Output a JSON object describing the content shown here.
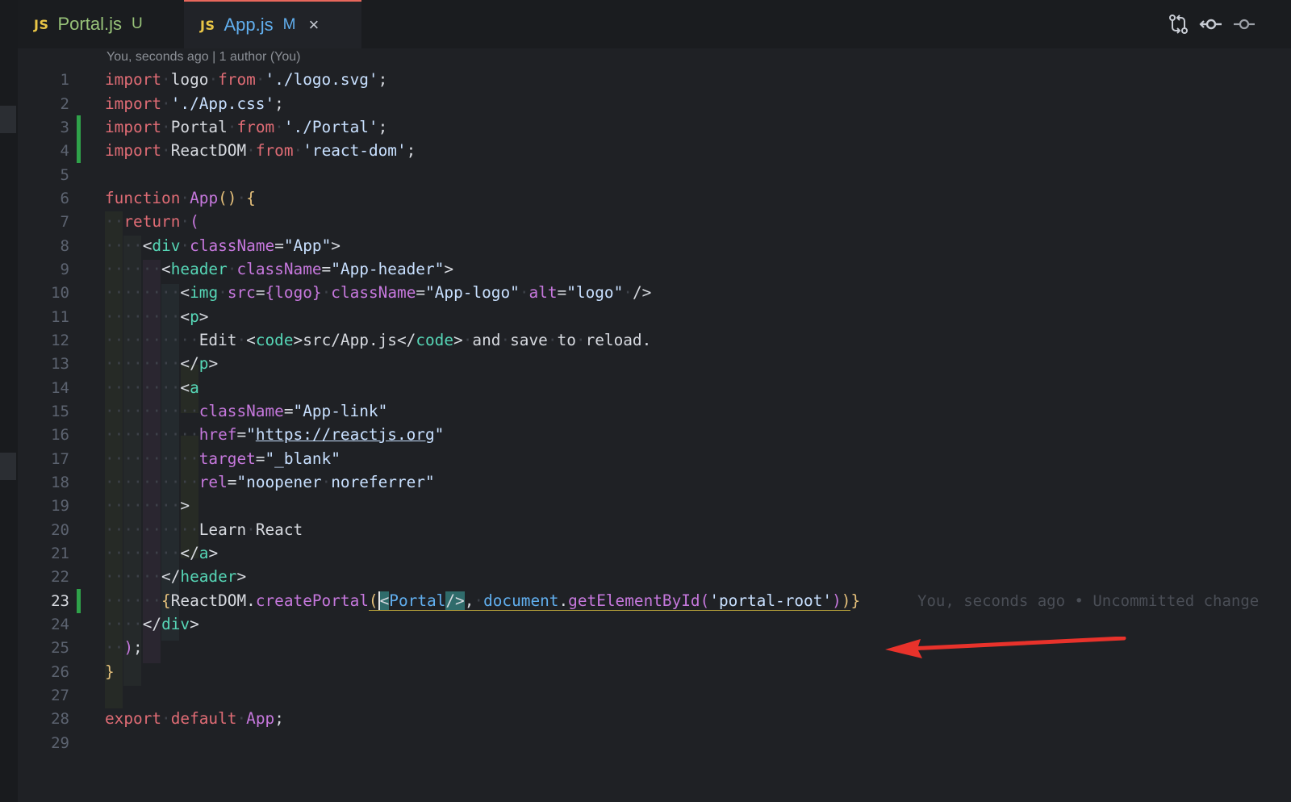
{
  "tabs": [
    {
      "badge": "JS",
      "name": "Portal.js",
      "status": "U"
    },
    {
      "badge": "JS",
      "name": "App.js",
      "status": "M",
      "close": "×"
    }
  ],
  "toolbar": {
    "icons": [
      "compare-changes-icon",
      "git-commit-prev-icon",
      "git-commit-next-icon"
    ]
  },
  "blame_header": "You, seconds ago | 1 author (You)",
  "ghost_blame": "You, seconds ago • Uncommitted change",
  "code_lines": [
    {
      "n": "1",
      "text": "import logo from './logo.svg';"
    },
    {
      "n": "2",
      "text": "import './App.css';"
    },
    {
      "n": "3",
      "text": "import Portal from './Portal';"
    },
    {
      "n": "4",
      "text": "import ReactDOM from 'react-dom';"
    },
    {
      "n": "5",
      "text": ""
    },
    {
      "n": "6",
      "text": "function App() {"
    },
    {
      "n": "7",
      "text": "  return ("
    },
    {
      "n": "8",
      "text": "    <div className=\"App\">"
    },
    {
      "n": "9",
      "text": "      <header className=\"App-header\">"
    },
    {
      "n": "10",
      "text": "        <img src={logo} className=\"App-logo\" alt=\"logo\" />"
    },
    {
      "n": "11",
      "text": "        <p>"
    },
    {
      "n": "12",
      "text": "          Edit <code>src/App.js</code> and save to reload."
    },
    {
      "n": "13",
      "text": "        </p>"
    },
    {
      "n": "14",
      "text": "        <a"
    },
    {
      "n": "15",
      "text": "          className=\"App-link\""
    },
    {
      "n": "16",
      "text": "          href=\"https://reactjs.org\""
    },
    {
      "n": "17",
      "text": "          target=\"_blank\""
    },
    {
      "n": "18",
      "text": "          rel=\"noopener noreferrer\""
    },
    {
      "n": "19",
      "text": "        >"
    },
    {
      "n": "20",
      "text": "          Learn React"
    },
    {
      "n": "21",
      "text": "        </a>"
    },
    {
      "n": "22",
      "text": "      </header>"
    },
    {
      "n": "23",
      "text": "      {ReactDOM.createPortal(<Portal/>, document.getElementById('portal-root'))}"
    },
    {
      "n": "24",
      "text": "    </div>"
    },
    {
      "n": "25",
      "text": "  );"
    },
    {
      "n": "26",
      "text": "}"
    },
    {
      "n": "27",
      "text": ""
    },
    {
      "n": "28",
      "text": "export default App;"
    },
    {
      "n": "29",
      "text": ""
    }
  ],
  "colors": {
    "accent_tab_border": "#e8675c",
    "modified_gutter": "#2fa24a",
    "annotation_arrow": "#e8322b"
  }
}
